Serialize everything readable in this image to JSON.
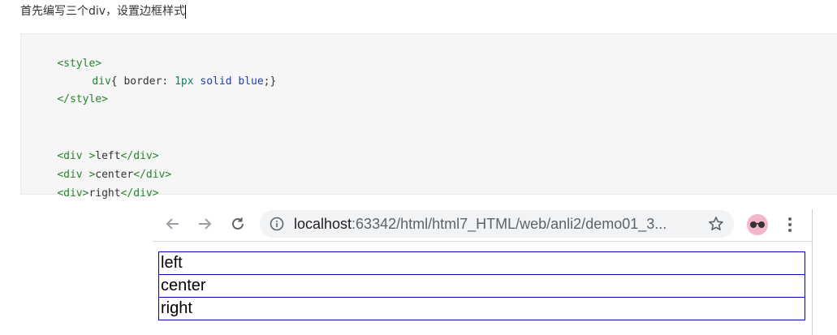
{
  "article": {
    "heading": "首先编写三个div，设置边框样式"
  },
  "code": {
    "style_open": "<style>",
    "selector": "div",
    "brace_open": "{ ",
    "property": "border: ",
    "value_width": "1px",
    "value_style": "solid",
    "value_color": "blue",
    "rule_end": ";}",
    "style_close": "</style>",
    "div1_open": "<div >",
    "div1_text": "left",
    "div1_close": "</div>",
    "div2_open": "<div >",
    "div2_text": "center",
    "div2_close": "</div>",
    "div3_open": "<div>",
    "div3_text": "right",
    "div3_close": "</div>"
  },
  "browser": {
    "url_host": "localhost",
    "url_path": ":63342/html/html7_HTML/web/anli2/demo01_3..."
  },
  "rendered_divs": [
    "left",
    "center",
    "right"
  ],
  "colors": {
    "code_background": "#f6f6f6",
    "tag_color": "#25852d",
    "div_border": "#0000c8"
  },
  "icons": [
    "back-arrow-icon",
    "forward-arrow-icon",
    "reload-icon",
    "info-icon",
    "star-icon",
    "extension-glasses-icon",
    "more-vert-icon"
  ]
}
